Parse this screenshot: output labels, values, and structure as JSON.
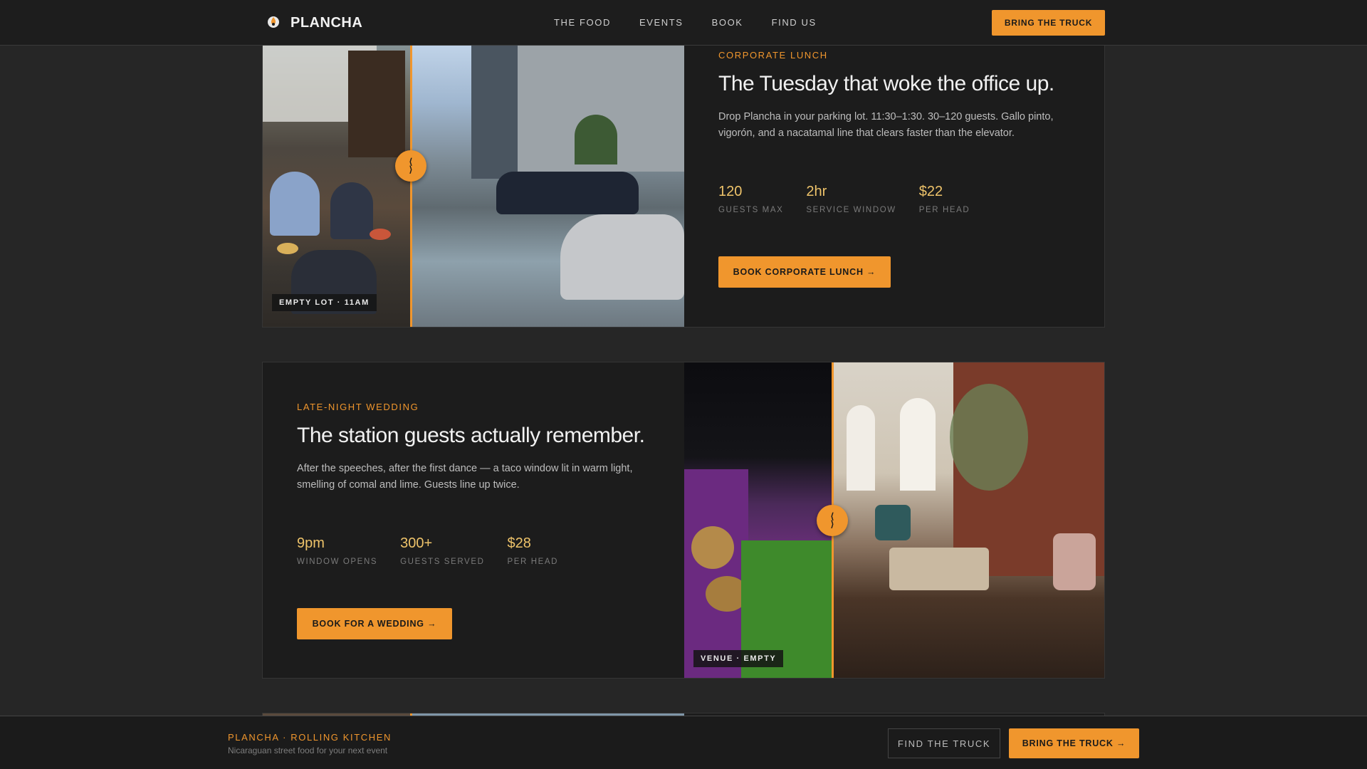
{
  "nav": {
    "brand": "PLANCHA",
    "links": [
      "THE FOOD",
      "EVENTS",
      "BOOK",
      "FIND US"
    ],
    "cta": "BRING THE TRUCK"
  },
  "events": [
    {
      "eyebrow": "CORPORATE LUNCH",
      "headline": "The Tuesday that woke the office up.",
      "body": "Drop Plancha in your parking lot. 11:30–1:30. 30–120 guests. Gallo pinto, vigorón, and a nacatamal line that clears faster than the elevator.",
      "stats": [
        {
          "value": "120",
          "label": "GUESTS MAX"
        },
        {
          "value": "2hr",
          "label": "SERVICE WINDOW"
        },
        {
          "value": "$22",
          "label": "PER HEAD"
        }
      ],
      "cta": "BOOK CORPORATE LUNCH →",
      "photo_tag": "EMPTY LOT · 11AM"
    },
    {
      "eyebrow": "LATE-NIGHT WEDDING",
      "headline": "The station guests actually remember.",
      "body": "After the speeches, after the first dance — a taco window lit in warm light, smelling of comal and lime. Guests line up twice.",
      "stats": [
        {
          "value": "9pm",
          "label": "WINDOW OPENS"
        },
        {
          "value": "300+",
          "label": "GUESTS SERVED"
        },
        {
          "value": "$28",
          "label": "PER HEAD"
        }
      ],
      "cta": "BOOK FOR A WEDDING →",
      "photo_tag": "VENUE · EMPTY"
    }
  ],
  "compare_handle": {
    "top": "⟨",
    "bottom": "⟩"
  },
  "footer": {
    "title": "PLANCHA · ROLLING KITCHEN",
    "subtitle": "Nicaraguan street food for your next event",
    "ghost_cta": "FIND THE TRUCK",
    "cta": "BRING THE TRUCK →"
  },
  "colors": {
    "accent": "#f0962d",
    "stat": "#eec36a",
    "background": "#262626",
    "card": "#1c1c1c"
  },
  "icons": {
    "brand": "flame-logo-icon",
    "compare": "compare-slider-handle-icon"
  }
}
